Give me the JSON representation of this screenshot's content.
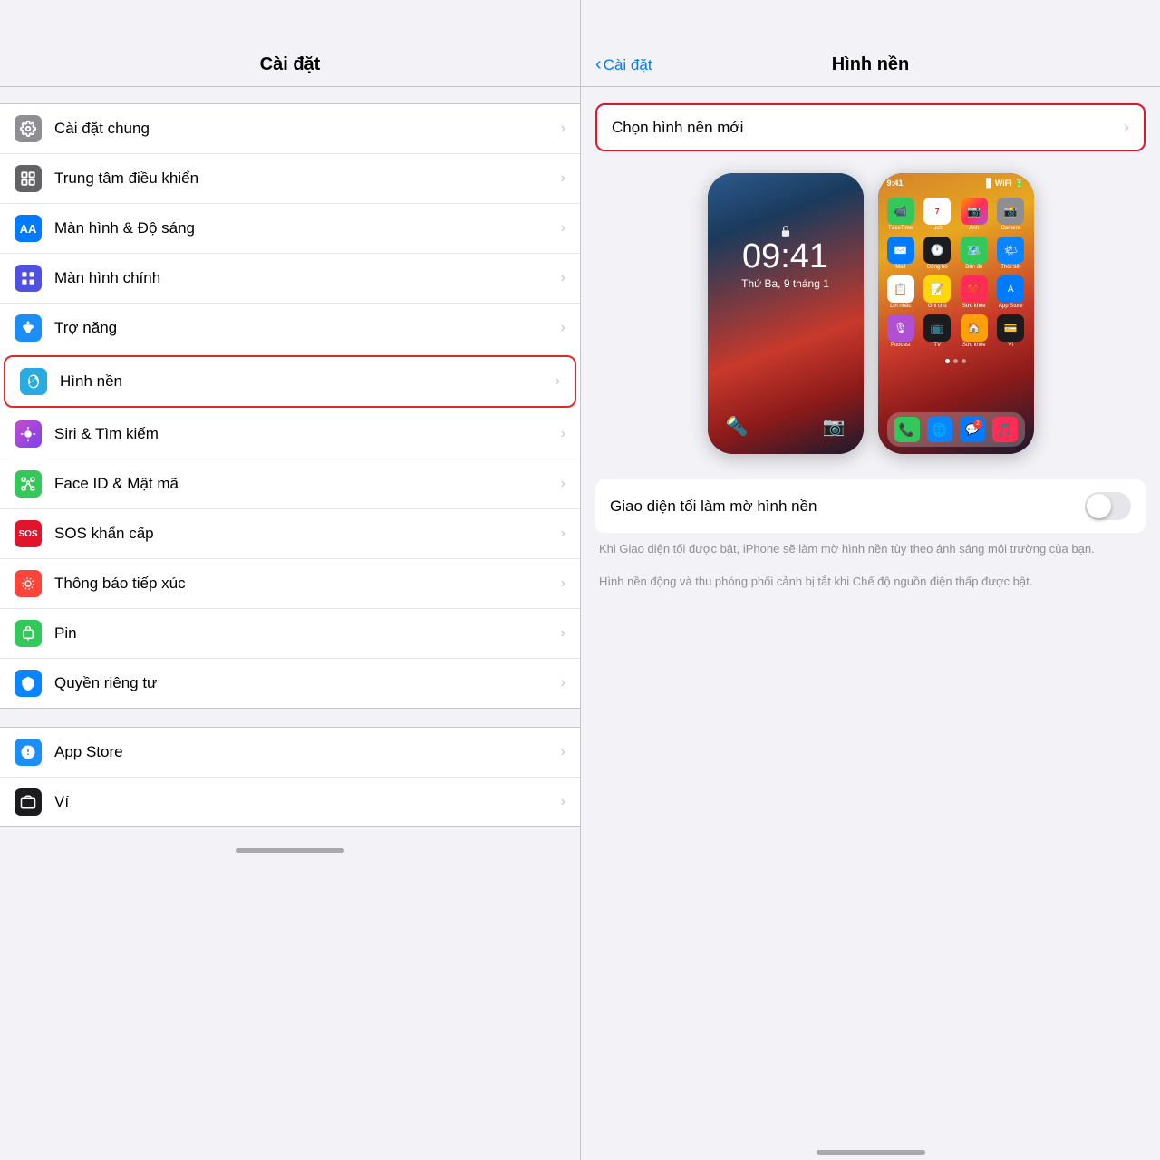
{
  "left": {
    "header": "Cài đặt",
    "items": [
      {
        "id": "cai-dat-chung",
        "label": "Cài đặt chung",
        "iconClass": "gray",
        "iconText": "⚙️",
        "highlighted": false
      },
      {
        "id": "trung-tam-dieu-khien",
        "label": "Trung tâm điều khiển",
        "iconClass": "blue-dark",
        "iconText": "⊞",
        "highlighted": false
      },
      {
        "id": "man-hinh-do-sang",
        "label": "Màn hình & Độ sáng",
        "iconClass": "blue",
        "iconText": "AA",
        "highlighted": false
      },
      {
        "id": "man-hinh-chinh",
        "label": "Màn hình chính",
        "iconClass": "purple-blue",
        "iconText": "⊞",
        "highlighted": false
      },
      {
        "id": "tro-nang",
        "label": "Trợ năng",
        "iconClass": "blue-light",
        "iconText": "♿",
        "highlighted": false
      },
      {
        "id": "hinh-nen",
        "label": "Hình nền",
        "iconClass": "flower",
        "iconText": "✿",
        "highlighted": true
      },
      {
        "id": "siri-tim-kiem",
        "label": "Siri & Tìm kiếm",
        "iconClass": "siri",
        "iconText": "◎",
        "highlighted": false
      },
      {
        "id": "face-id",
        "label": "Face ID & Mật mã",
        "iconClass": "green-face",
        "iconText": "🙂",
        "highlighted": false
      },
      {
        "id": "sos",
        "label": "SOS khẩn cấp",
        "iconClass": "red-sos",
        "iconText": "SOS",
        "highlighted": false
      },
      {
        "id": "thong-bao-tiep-xuc",
        "label": "Thông báo tiếp xúc",
        "iconClass": "red-dot",
        "iconText": "◉",
        "highlighted": false
      },
      {
        "id": "pin",
        "label": "Pin",
        "iconClass": "green-bat",
        "iconText": "🔋",
        "highlighted": false
      },
      {
        "id": "quyen-rieng-tu",
        "label": "Quyền riêng tư",
        "iconClass": "blue-hand",
        "iconText": "✋",
        "highlighted": false
      }
    ],
    "items2": [
      {
        "id": "app-store",
        "label": "App Store",
        "iconClass": "blue-store",
        "iconText": "A",
        "highlighted": false
      },
      {
        "id": "vi",
        "label": "Ví",
        "iconClass": "black-wallet",
        "iconText": "💳",
        "highlighted": false
      }
    ]
  },
  "right": {
    "back_label": "Cài đặt",
    "title": "Hình nền",
    "choose_label": "Chọn hình nền mới",
    "toggle_label": "Giao diện tối làm mờ hình nền",
    "desc1": "Khi Giao diện tối được bật, iPhone sẽ làm mờ hình nền tùy theo ánh sáng môi trường của bạn.",
    "desc2": "Hình nền động và thu phóng phối cảnh bị tắt khi Chế độ nguồn điện thấp được bật.",
    "lockscreen_time": "09:41",
    "lockscreen_date": "Thứ Ba, 9 tháng 1",
    "homescreen_time": "09:41"
  }
}
